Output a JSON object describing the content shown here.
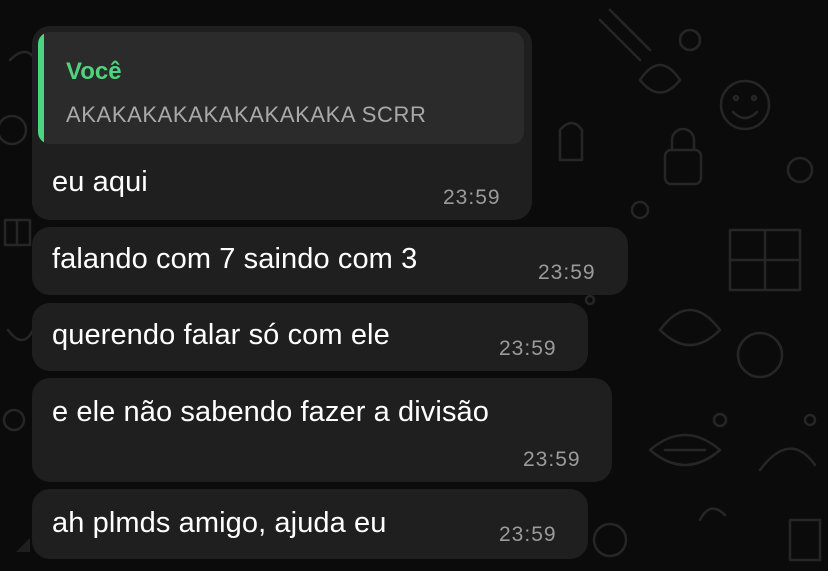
{
  "colors": {
    "bubble": "#1f1f1f",
    "quote_bg": "#2b2b2b",
    "quote_accent": "#4dd47c",
    "text": "#ffffff",
    "time": "#9b9b9b",
    "wallpaper": "#0b0b0b"
  },
  "reply": {
    "author": "Você",
    "text": "AKAKAKAKAKAKAKAKAKA SCRR"
  },
  "messages": [
    {
      "text": "eu aqui",
      "time": "23:59"
    },
    {
      "text": "falando com 7 saindo com 3",
      "time": "23:59"
    },
    {
      "text": "querendo falar só com ele",
      "time": "23:59"
    },
    {
      "text": "e ele não sabendo fazer a divisão",
      "time": "23:59"
    },
    {
      "text": "ah plmds amigo, ajuda eu",
      "time": "23:59"
    }
  ]
}
